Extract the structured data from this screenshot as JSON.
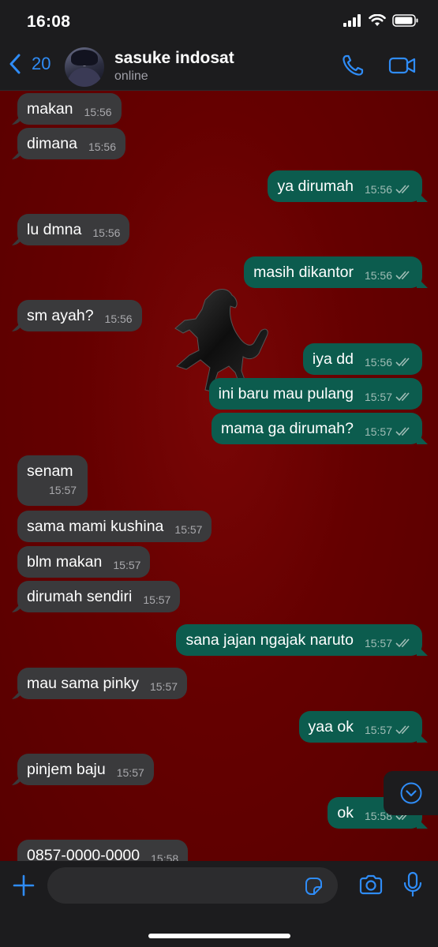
{
  "status_bar": {
    "time": "16:08"
  },
  "header": {
    "back_count": "20",
    "contact_name": "sasuke indosat",
    "contact_status": "online"
  },
  "colors": {
    "accent": "#2f8cf6",
    "incoming": "#3a3a3c",
    "outgoing": "#0c5c4e",
    "wallpaper": "#650000"
  },
  "messages": [
    {
      "dir": "in",
      "text": "makan",
      "time": "15:56"
    },
    {
      "dir": "in",
      "text": "dimana",
      "time": "15:56"
    },
    {
      "dir": "out",
      "text": "ya dirumah",
      "time": "15:56"
    },
    {
      "dir": "in",
      "text": "lu dmna",
      "time": "15:56"
    },
    {
      "dir": "out",
      "text": "masih dikantor",
      "time": "15:56"
    },
    {
      "dir": "in",
      "text": "sm ayah?",
      "time": "15:56"
    },
    {
      "dir": "out",
      "text": "iya dd",
      "time": "15:56"
    },
    {
      "dir": "out",
      "text": "ini baru mau pulang",
      "time": "15:57"
    },
    {
      "dir": "out",
      "text": "mama ga dirumah?",
      "time": "15:57"
    },
    {
      "dir": "in",
      "text": "senam",
      "time": "15:57"
    },
    {
      "dir": "in",
      "text": "sama mami kushina",
      "time": "15:57"
    },
    {
      "dir": "in",
      "text": "blm makan",
      "time": "15:57"
    },
    {
      "dir": "in",
      "text": "dirumah sendiri",
      "time": "15:57"
    },
    {
      "dir": "out",
      "text": "sana jajan ngajak naruto",
      "time": "15:57"
    },
    {
      "dir": "in",
      "text": "mau sama pinky",
      "time": "15:57"
    },
    {
      "dir": "out",
      "text": "yaa ok",
      "time": "15:57"
    },
    {
      "dir": "in",
      "text": "pinjem baju",
      "time": "15:57"
    },
    {
      "dir": "out",
      "text": "ok",
      "time": "15:58"
    },
    {
      "dir": "in",
      "text": "0857-0000-0000",
      "time": "15:58"
    }
  ],
  "icons": {
    "back": "chevron-left-icon",
    "call": "phone-icon",
    "video": "video-camera-icon",
    "add": "plus-icon",
    "sticker": "sticker-icon",
    "camera": "camera-icon",
    "mic": "microphone-icon",
    "scroll": "chevron-down-circle-icon"
  }
}
